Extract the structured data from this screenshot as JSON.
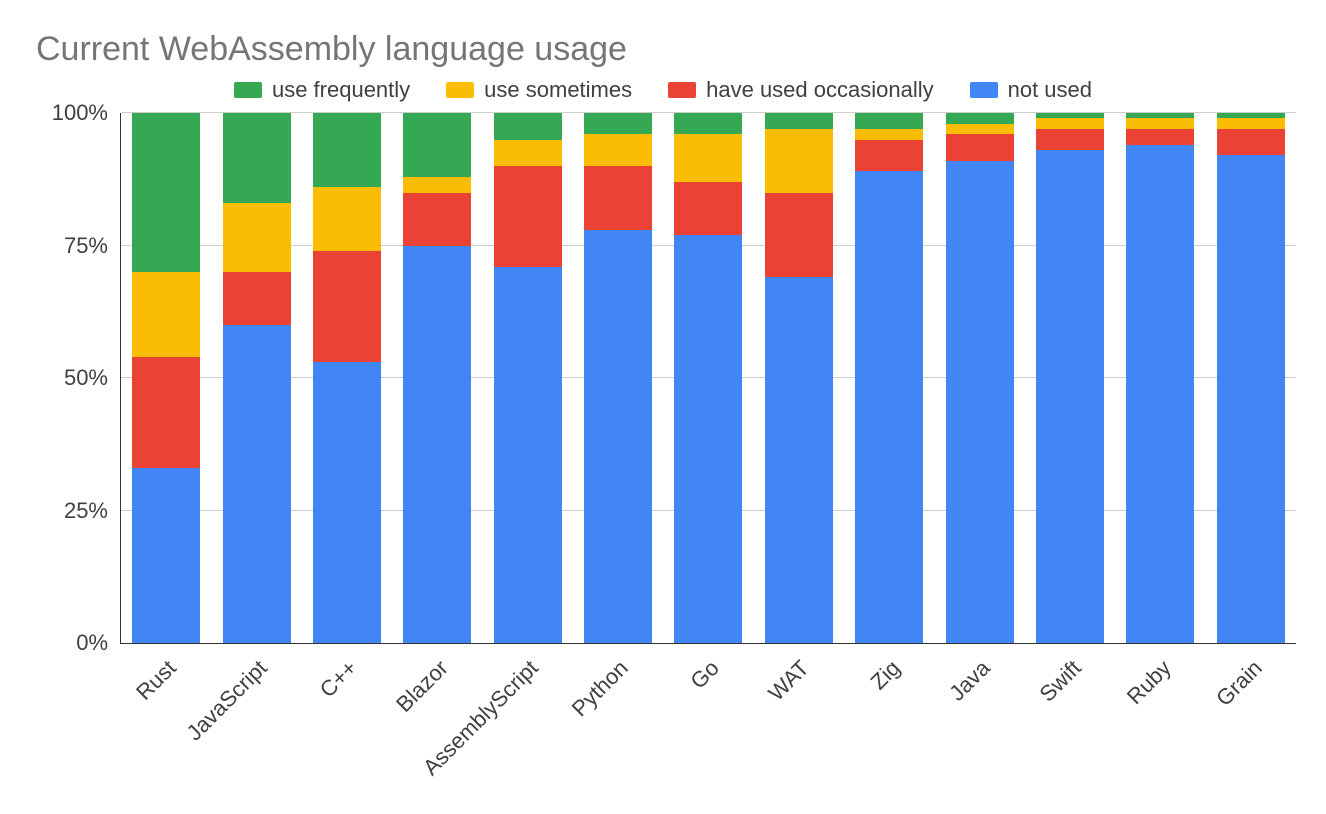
{
  "chart_data": {
    "type": "bar",
    "title": "Current WebAssembly language usage",
    "xlabel": "",
    "ylabel": "",
    "ylim": [
      0,
      100
    ],
    "y_ticks": [
      "0%",
      "25%",
      "50%",
      "75%",
      "100%"
    ],
    "categories": [
      "Rust",
      "JavaScript",
      "C++",
      "Blazor",
      "AssemblyScript",
      "Python",
      "Go",
      "WAT",
      "Zig",
      "Java",
      "Swift",
      "Ruby",
      "Grain"
    ],
    "series": [
      {
        "name": "use frequently",
        "color": "#34A853",
        "values": [
          30,
          17,
          14,
          12,
          5,
          4,
          4,
          3,
          3,
          2,
          1,
          1,
          1
        ]
      },
      {
        "name": "use sometimes",
        "color": "#FBBC04",
        "values": [
          16,
          13,
          12,
          3,
          5,
          6,
          9,
          12,
          2,
          2,
          2,
          2,
          2
        ]
      },
      {
        "name": "have used occasionally",
        "color": "#EA4335",
        "values": [
          21,
          10,
          21,
          10,
          19,
          12,
          10,
          16,
          6,
          5,
          4,
          3,
          5
        ]
      },
      {
        "name": "not used",
        "color": "#4285F4",
        "values": [
          33,
          60,
          53,
          75,
          71,
          78,
          77,
          69,
          89,
          91,
          93,
          94,
          92
        ]
      }
    ],
    "stack_order": [
      "not used",
      "have used occasionally",
      "use sometimes",
      "use frequently"
    ],
    "legend_position": "top"
  }
}
